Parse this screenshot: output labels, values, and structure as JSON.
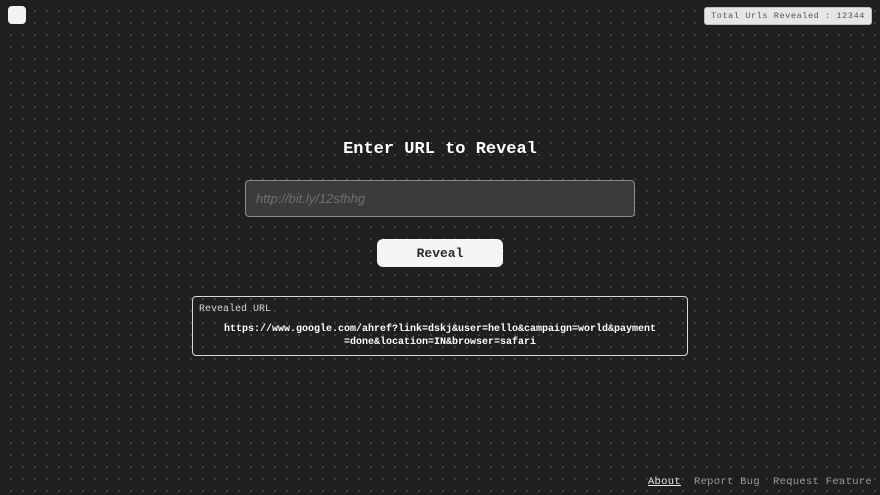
{
  "header": {
    "counter_text": "Total Urls Revealed : 12344"
  },
  "main": {
    "title": "Enter URL to Reveal",
    "input_placeholder": "http://bit.ly/12sfhhg",
    "input_value": "",
    "reveal_label": "Reveal"
  },
  "result": {
    "label": "Revealed URL",
    "url": "https://www.google.com/ahref?link=dskj&user=hello&campaign=world&payment=done&location=IN&browser=safari"
  },
  "footer": {
    "links": [
      "About",
      "Report Bug",
      "Request Feature"
    ]
  },
  "colors": {
    "background": "#1f1f1f",
    "input_background": "#3b3b3b",
    "button_background": "#f5f5f5"
  }
}
